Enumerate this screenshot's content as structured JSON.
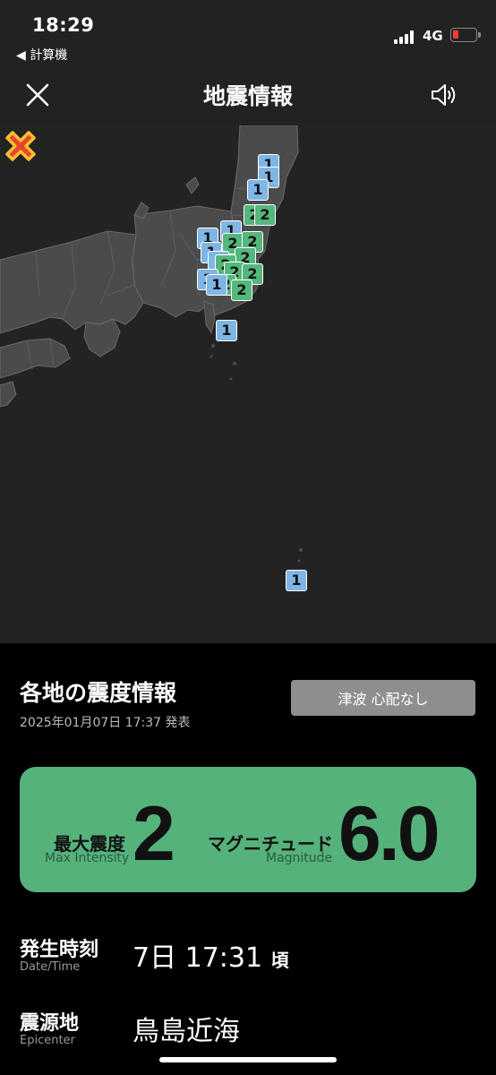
{
  "status_bar": {
    "time": "18:29",
    "back_app": "◀ 計算機",
    "network": "4G"
  },
  "header": {
    "title": "地震情報"
  },
  "map": {
    "markers": [
      {
        "level": 1
      },
      {
        "level": 1
      },
      {
        "level": 1
      },
      {
        "level": 2
      },
      {
        "level": 2
      },
      {
        "level": 1
      },
      {
        "level": 1
      },
      {
        "level": 1
      },
      {
        "level": 2
      },
      {
        "level": 2
      },
      {
        "level": 1
      },
      {
        "level": 2
      },
      {
        "level": 2
      },
      {
        "level": 2
      },
      {
        "level": 1
      },
      {
        "level": 2
      },
      {
        "level": 2
      },
      {
        "level": 2
      },
      {
        "level": 1
      },
      {
        "level": 1
      },
      {
        "level": 1
      }
    ],
    "colors": {
      "level1": "#7fb6e6",
      "level2": "#54b77c",
      "epicenter": "#e8442c"
    }
  },
  "panel": {
    "title": "各地の震度情報",
    "issued": "2025年01月07日 17:37 発表",
    "tsunami": "津波 心配なし"
  },
  "intensity_card": {
    "max_label_jp": "最大震度",
    "max_label_en": "Max Intensity",
    "max_value": "2",
    "mag_label_jp": "マグニチュード",
    "mag_label_en": "Magnitude",
    "mag_value": "6.0",
    "color": "#55b27b"
  },
  "details": {
    "time_label_jp": "発生時刻",
    "time_label_en": "Date/Time",
    "time_value": "7日 17:31",
    "time_suffix": "頃",
    "epicenter_label_jp": "震源地",
    "epicenter_label_en": "Epicenter",
    "epicenter_value": "鳥島近海"
  }
}
